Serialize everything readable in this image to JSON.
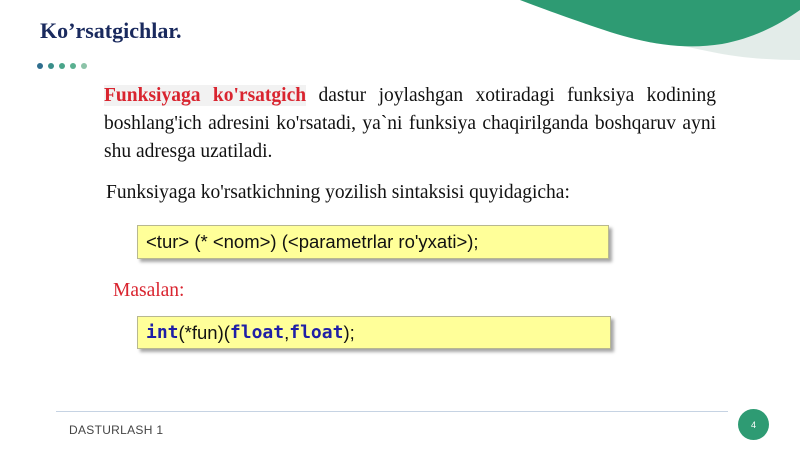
{
  "slide": {
    "title": "Ko’rsatgichlar.",
    "definition_term": "Funksiyaga ko'rsatgich",
    "definition_text": " dastur joylashgan xotiradagi funksiya kodining boshlang'ich adresini ko'rsatadi, ya`ni funksiya chaqirilganda boshqaruv ayni shu adresga uzatiladi.",
    "syntax_intro": "Funksiyaga ko'rsatkichning yozilish sintaksisi quyidagicha:",
    "syntax": "<tur> (* <nom>) (<parametrlar ro'yxati>);",
    "example_label": "Masalan:",
    "example": {
      "kw_int": "int",
      "part1": " (*fun)(",
      "kw_float1": "float",
      "comma": ",",
      "kw_float2": "float",
      "part2": ");"
    },
    "footer": "DASTURLASH 1",
    "page_number": "4"
  },
  "colors": {
    "title": "#1a2a5e",
    "accent_red": "#d9242f",
    "code_background": "#ffff99",
    "keyword": "#1f1fa6",
    "page_badge": "#2e9b73",
    "wave_dark": "#2e9b73",
    "wave_light": "#e3ece9",
    "dots": [
      "#2f6e8e",
      "#3a8f8a",
      "#4aa58a",
      "#5ab090",
      "#8cc3a8"
    ]
  }
}
